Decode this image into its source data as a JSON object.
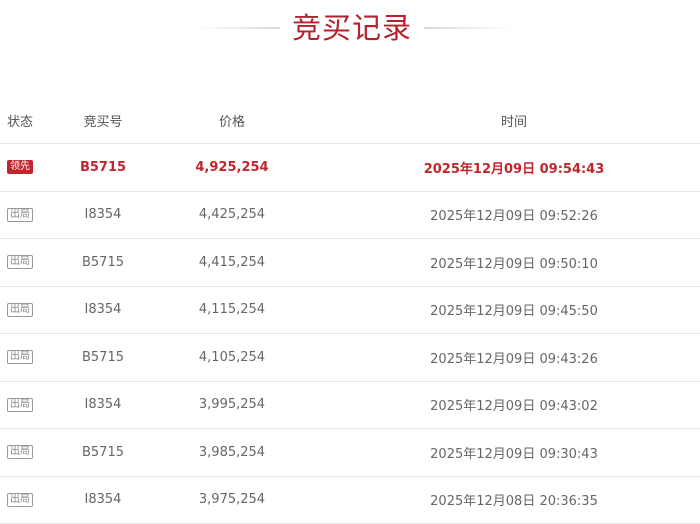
{
  "title": "竞买记录",
  "columns": {
    "status": "状态",
    "bid_no": "竞买号",
    "price": "价格",
    "time": "时间"
  },
  "rows": [
    {
      "status": "领先",
      "bid_no": "B5715",
      "price": "4,925,254",
      "time": "2025年12月09日  09:54:43"
    },
    {
      "status": "出局",
      "bid_no": "I8354",
      "price": "4,425,254",
      "time": "2025年12月09日  09:52:26"
    },
    {
      "status": "出局",
      "bid_no": "B5715",
      "price": "4,415,254",
      "time": "2025年12月09日  09:50:10"
    },
    {
      "status": "出局",
      "bid_no": "I8354",
      "price": "4,115,254",
      "time": "2025年12月09日  09:45:50"
    },
    {
      "status": "出局",
      "bid_no": "B5715",
      "price": "4,105,254",
      "time": "2025年12月09日  09:43:26"
    },
    {
      "status": "出局",
      "bid_no": "I8354",
      "price": "3,995,254",
      "time": "2025年12月09日  09:43:02"
    },
    {
      "status": "出局",
      "bid_no": "B5715",
      "price": "3,985,254",
      "time": "2025年12月09日  09:30:43"
    },
    {
      "status": "出局",
      "bid_no": "I8354",
      "price": "3,975,254",
      "time": "2025年12月08日  20:36:35"
    }
  ],
  "colors": {
    "accent": "#b5202e",
    "leading": "#c0262d",
    "text": "#666666",
    "divider": "#e6e6e6"
  }
}
